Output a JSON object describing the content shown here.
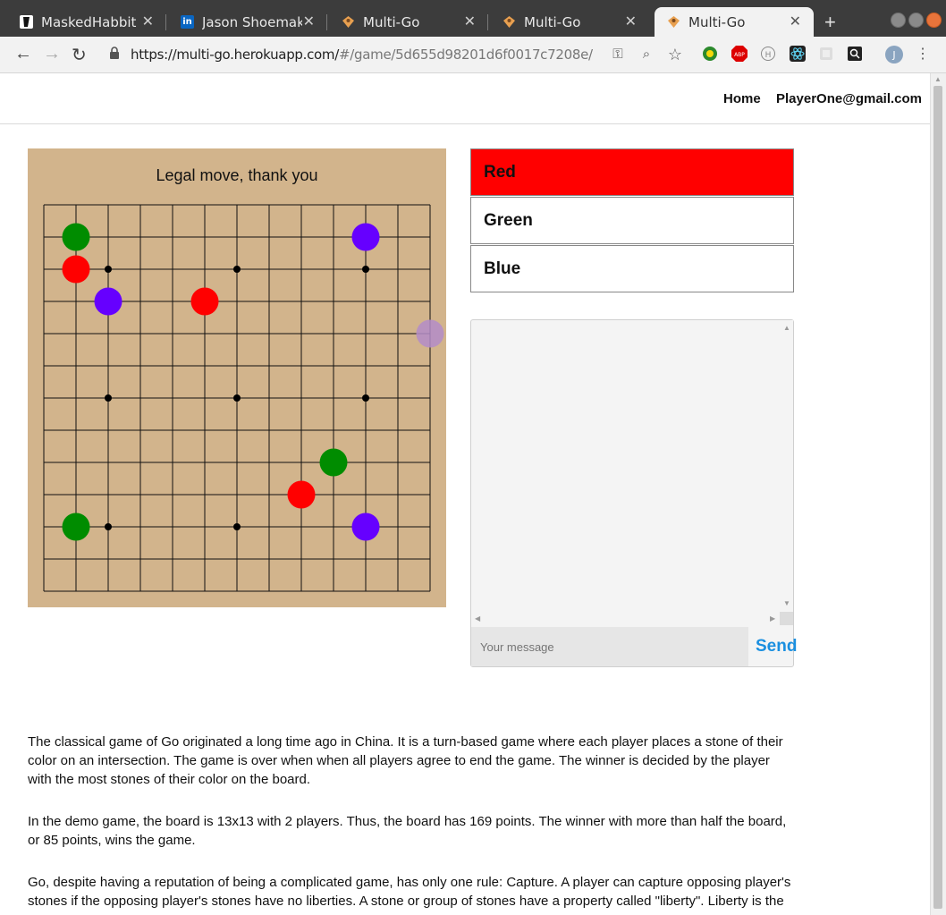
{
  "browser": {
    "tabs": [
      {
        "title": "MaskedHabbit",
        "icon": "masked-habbit-icon"
      },
      {
        "title": "Jason Shoemaker",
        "icon": "linkedin-icon"
      },
      {
        "title": "Multi-Go",
        "icon": "go-board-icon"
      },
      {
        "title": "Multi-Go",
        "icon": "go-board-icon"
      },
      {
        "title": "Multi-Go",
        "icon": "go-board-icon",
        "active": true
      }
    ],
    "url_host": "https://multi-go.herokuapp.com/",
    "url_path": "#/game/5d655d98201d6f0017c7208e/"
  },
  "nav": {
    "home": "Home",
    "user": "PlayerOne@gmail.com"
  },
  "game": {
    "status": "Legal move, thank you",
    "board_size": 13,
    "star_points": [
      [
        2,
        2
      ],
      [
        6,
        2
      ],
      [
        10,
        2
      ],
      [
        2,
        6
      ],
      [
        6,
        6
      ],
      [
        10,
        6
      ],
      [
        2,
        10
      ],
      [
        6,
        10
      ],
      [
        10,
        10
      ]
    ],
    "stones": [
      {
        "col": 1,
        "row": 1,
        "color": "#008c00"
      },
      {
        "col": 10,
        "row": 1,
        "color": "#6600ff"
      },
      {
        "col": 1,
        "row": 2,
        "color": "#ff0000"
      },
      {
        "col": 2,
        "row": 3,
        "color": "#6600ff"
      },
      {
        "col": 5,
        "row": 3,
        "color": "#ff0000"
      },
      {
        "col": 9,
        "row": 8,
        "color": "#008c00"
      },
      {
        "col": 8,
        "row": 9,
        "color": "#ff0000"
      },
      {
        "col": 1,
        "row": 10,
        "color": "#008c00"
      },
      {
        "col": 10,
        "row": 10,
        "color": "#6600ff"
      }
    ],
    "hover_stone": {
      "col": 12,
      "row": 4,
      "color": "#b48cc8"
    }
  },
  "players": [
    {
      "name": "Red",
      "background": "#ff0000",
      "active": true
    },
    {
      "name": "Green",
      "background": "#ffffff",
      "active": false
    },
    {
      "name": "Blue",
      "background": "#ffffff",
      "active": false
    }
  ],
  "chat": {
    "placeholder": "Your message",
    "send_label": "Send"
  },
  "description": [
    "The classical game of Go originated a long time ago in China. It is a turn-based game where each player places a stone of their color on an intersection. The game is over when when all players agree to end the game. The winner is decided by the player with the most stones of their color on the board.",
    "In the demo game, the board is 13x13 with 2 players. Thus, the board has 169 points. The winner with more than half the board, or 85 points, wins the game.",
    "Go, despite having a reputation of being a complicated game, has only one rule: Capture. A player can capture opposing player's stones if the opposing player's stones have no liberties. A stone or group of stones have a property called \"liberty\". Liberty is the"
  ]
}
